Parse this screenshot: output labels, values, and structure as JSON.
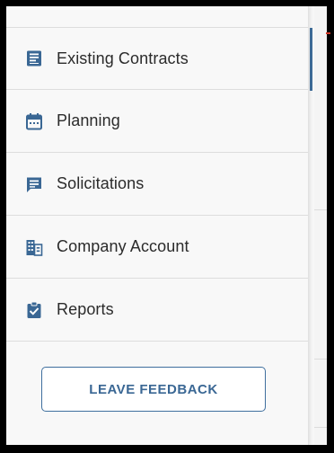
{
  "menu": {
    "items": [
      {
        "label": "Existing Contracts",
        "icon": "contract-list-icon",
        "active": true
      },
      {
        "label": "Planning",
        "icon": "calendar-icon",
        "active": false
      },
      {
        "label": "Solicitations",
        "icon": "chat-list-icon",
        "active": false
      },
      {
        "label": "Company Account",
        "icon": "building-icon",
        "active": false
      },
      {
        "label": "Reports",
        "icon": "clipboard-check-icon",
        "active": false
      }
    ]
  },
  "feedback": {
    "label": "LEAVE FEEDBACK"
  },
  "colors": {
    "accent": "#3f6f9e",
    "icon": "#3a6794",
    "frame": "#000000"
  }
}
